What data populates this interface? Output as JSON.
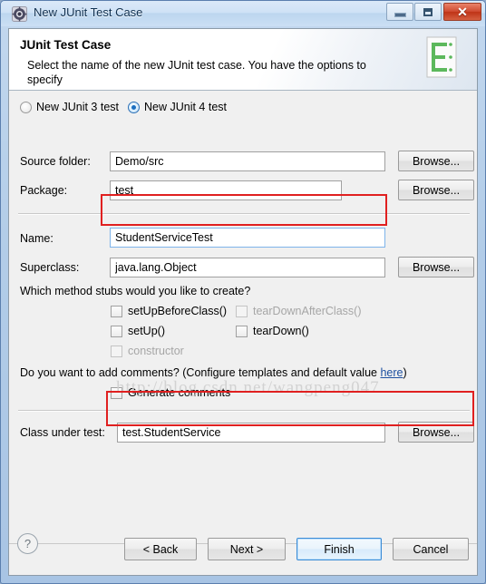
{
  "window": {
    "title": "New JUnit Test Case",
    "icon": "junit-wizard-icon",
    "controls": {
      "minimize": "minimize-button",
      "maximize": "restore-button",
      "close": "✕"
    }
  },
  "header": {
    "title": "JUnit Test Case",
    "description": "Select the name of the new JUnit test case. You have the options to specify",
    "icon": "junit-banner-icon"
  },
  "form": {
    "version_radios": [
      {
        "label": "New JUnit 3 test",
        "selected": false
      },
      {
        "label": "New JUnit 4 test",
        "selected": true
      }
    ],
    "fields": [
      {
        "label": "Source folder:",
        "value": "Demo/src",
        "browse": "Browse...",
        "focused": false
      },
      {
        "label": "Package:",
        "value": "test",
        "browse": "Browse...",
        "focused": false
      },
      {
        "label": "Name:",
        "value": "StudentServiceTest",
        "browse": "",
        "focused": true
      },
      {
        "label": "Superclass:",
        "value": "java.lang.Object",
        "browse": "Browse...",
        "focused": false
      }
    ],
    "stubs_question": "Which method stubs would you like to create?",
    "stubs": [
      {
        "label": "setUpBeforeClass()",
        "checked": false,
        "disabled": false
      },
      {
        "label": "tearDownAfterClass()",
        "checked": false,
        "disabled": true
      },
      {
        "label": "setUp()",
        "checked": false,
        "disabled": false
      },
      {
        "label": "tearDown()",
        "checked": false,
        "disabled": false
      },
      {
        "label": "constructor",
        "checked": false,
        "disabled": true
      }
    ],
    "comments_question_pre": "Do you want to add comments? (Configure templates and default value ",
    "comments_link": "here",
    "comments_question_post": ")",
    "generate_comments": {
      "label": "Generate comments",
      "checked": false
    },
    "class_under_test": {
      "label": "Class under test:",
      "value": "test.StudentService",
      "browse": "Browse..."
    }
  },
  "footer": {
    "help": "?",
    "buttons": [
      {
        "label": "< Back",
        "default": false
      },
      {
        "label": "Next >",
        "default": false
      },
      {
        "label": "Finish",
        "default": true
      },
      {
        "label": "Cancel",
        "default": false
      }
    ]
  },
  "annotations": {
    "name_highlight": "red-rectangle-name-field",
    "class_highlight": "red-rectangle-class-under-test",
    "watermark": "http://blog.csdn.net/wangpeng047"
  },
  "colors": {
    "accent": "#1c6fc0",
    "annotation": "#e02020",
    "link": "#1d4fa0",
    "titlebar": "#cfe2f6"
  }
}
